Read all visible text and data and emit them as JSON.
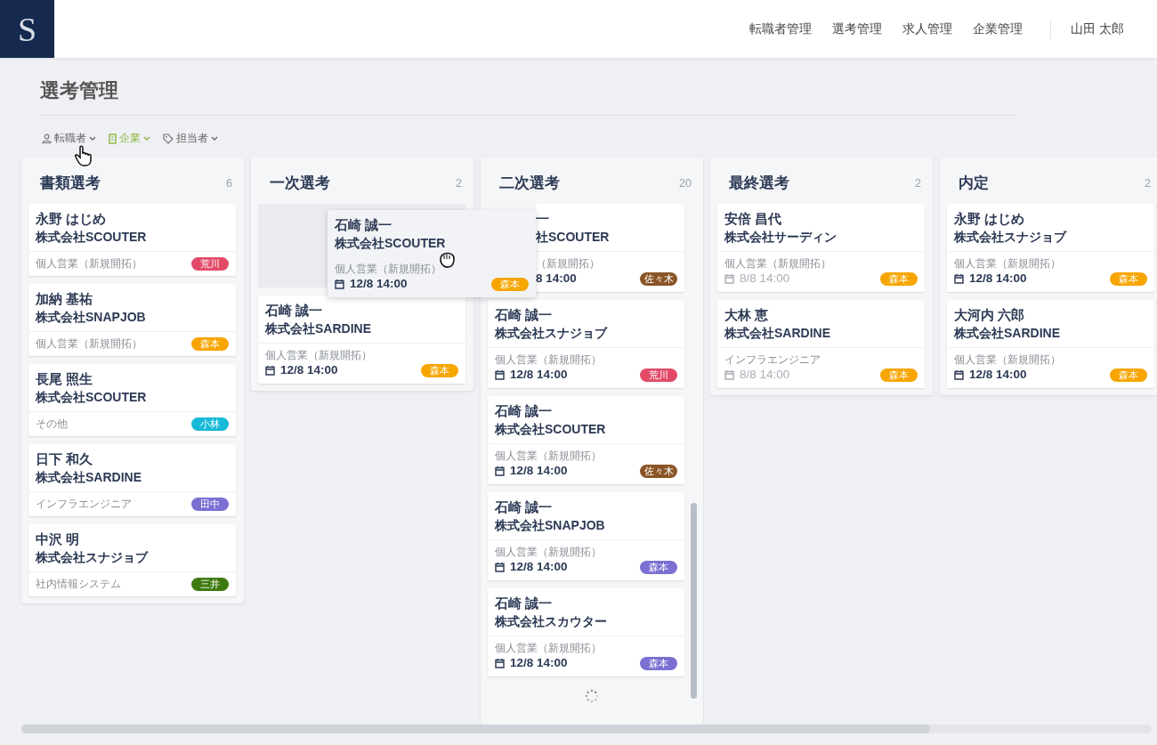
{
  "logo": "S",
  "nav": [
    {
      "label": "転職者管理"
    },
    {
      "label": "選考管理"
    },
    {
      "label": "求人管理"
    },
    {
      "label": "企業管理"
    }
  ],
  "user": "山田 太郎",
  "page_title": "選考管理",
  "filters": [
    {
      "label": "転職者",
      "selected": false
    },
    {
      "label": "企業",
      "selected": true
    },
    {
      "label": "担当者",
      "selected": false
    }
  ],
  "columns": [
    {
      "title": "書類選考",
      "count": "6",
      "loading": false,
      "cards": [
        {
          "kind": "card",
          "name": "永野 はじめ",
          "company": "株式会社SCOUTER",
          "job": "個人営業（新規開拓）",
          "assignee": {
            "label": "荒川",
            "color": "#e24a68"
          }
        },
        {
          "kind": "card",
          "name": "加納 基祐",
          "company": "株式会社SNAPJOB",
          "job": "個人営業（新規開拓）",
          "assignee": {
            "label": "森本",
            "color": "#f7a500"
          }
        },
        {
          "kind": "card",
          "name": "長尾 照生",
          "company": "株式会社SCOUTER",
          "job": "その他",
          "assignee": {
            "label": "小林",
            "color": "#17b9d8"
          }
        },
        {
          "kind": "card",
          "name": "日下 和久",
          "company": "株式会社SARDINE",
          "job": "インフラエンジニア",
          "assignee": {
            "label": "田中",
            "color": "#7b6fd2"
          }
        },
        {
          "kind": "card",
          "name": "中沢 明",
          "company": "株式会社スナジョブ",
          "job": "社内情報システム",
          "assignee": {
            "label": "三井",
            "color": "#3e7a10"
          }
        }
      ]
    },
    {
      "title": "一次選考",
      "count": "2",
      "loading": false,
      "cards": [
        {
          "kind": "placeholder"
        },
        {
          "kind": "card",
          "name": "石崎 誠一",
          "company": "株式会社SARDINE",
          "job": "個人営業（新規開拓）",
          "date": "12/8 14:00",
          "date_muted": false,
          "assignee": {
            "label": "森本",
            "color": "#f7a500"
          }
        }
      ]
    },
    {
      "title": "二次選考",
      "count": "20",
      "loading": true,
      "cards": [
        {
          "kind": "covered",
          "name": "一",
          "company": "社SCOUTER",
          "job": "（新規開拓）",
          "date": "8 14:00",
          "date_muted": false,
          "assignee": {
            "label": "佐々木",
            "color": "#8a5526"
          }
        },
        {
          "kind": "card",
          "name": "石崎 誠一",
          "company": "株式会社スナジョブ",
          "job": "個人営業（新規開拓）",
          "date": "12/8 14:00",
          "date_muted": false,
          "assignee": {
            "label": "荒川",
            "color": "#e24a68"
          }
        },
        {
          "kind": "card",
          "name": "石崎 誠一",
          "company": "株式会社SCOUTER",
          "job": "個人営業（新規開拓）",
          "date": "12/8 14:00",
          "date_muted": false,
          "assignee": {
            "label": "佐々木",
            "color": "#8a5526"
          }
        },
        {
          "kind": "card",
          "name": "石崎 誠一",
          "company": "株式会社SNAPJOB",
          "job": "個人営業（新規開拓）",
          "date": "12/8 14:00",
          "date_muted": false,
          "assignee": {
            "label": "森本",
            "color": "#7b6fd2"
          }
        },
        {
          "kind": "card",
          "name": "石崎 誠一",
          "company": "株式会社スカウター",
          "job": "個人営業（新規開拓）",
          "date": "12/8 14:00",
          "date_muted": false,
          "assignee": {
            "label": "森本",
            "color": "#7b6fd2"
          }
        }
      ]
    },
    {
      "title": "最終選考",
      "count": "2",
      "loading": false,
      "cards": [
        {
          "kind": "card",
          "name": "安倍 昌代",
          "company": "株式会社サーディン",
          "job": "個人営業（新規開拓）",
          "date": "8/8 14:00",
          "date_muted": true,
          "assignee": {
            "label": "森本",
            "color": "#f7a500"
          }
        },
        {
          "kind": "card",
          "name": "大林 恵",
          "company": "株式会社SARDINE",
          "job": "インフラエンジニア",
          "date": "8/8 14:00",
          "date_muted": true,
          "assignee": {
            "label": "森本",
            "color": "#f7a500"
          }
        }
      ]
    },
    {
      "title": "内定",
      "count": "2",
      "loading": false,
      "cards": [
        {
          "kind": "card",
          "name": "永野 はじめ",
          "company": "株式会社スナジョブ",
          "job": "個人営業（新規開拓）",
          "date": "12/8 14:00",
          "date_muted": false,
          "assignee": {
            "label": "森本",
            "color": "#f7a500"
          }
        },
        {
          "kind": "card",
          "name": "大河内 六郎",
          "company": "株式会社SARDINE",
          "job": "個人営業（新規開拓）",
          "date": "12/8 14:00",
          "date_muted": false,
          "assignee": {
            "label": "森本",
            "color": "#f7a500"
          }
        }
      ]
    }
  ],
  "dragged_card": {
    "name": "石崎 誠一",
    "company": "株式会社SCOUTER",
    "job": "個人営業（新規開拓）",
    "date": "12/8 14:00",
    "date_muted": false,
    "assignee": {
      "label": "森本",
      "color": "#f7a500"
    }
  }
}
